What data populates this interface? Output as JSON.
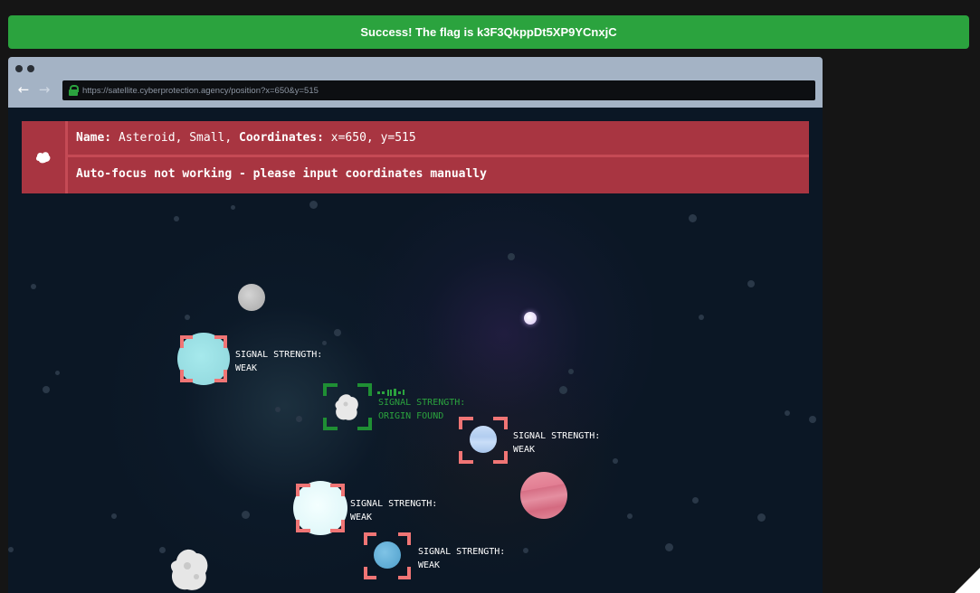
{
  "banner": {
    "text": "Success! The flag is k3F3QkppDt5XP9YCnxjC"
  },
  "browser": {
    "url": "https://satellite.cyberprotection.agency/position?x=650&y=515",
    "back_icon": "arrow-left-icon",
    "forward_icon": "arrow-right-icon",
    "lock_icon": "lock-icon"
  },
  "info": {
    "name_key": "Name:",
    "name_value": "Asteroid, Small,",
    "coords_key": "Coordinates:",
    "coords_value": "x=650, y=515",
    "message": "Auto-focus not working - please input coordinates manually"
  },
  "targets": [
    {
      "id": "cyan-planet",
      "label_line1": "SIGNAL STRENGTH:",
      "label_line2": "WEAK",
      "status": "weak"
    },
    {
      "id": "small-asteroid",
      "label_line1": "SIGNAL STRENGTH:",
      "label_line2": "ORIGIN FOUND",
      "status": "found"
    },
    {
      "id": "blue-planet",
      "label_line1": "SIGNAL STRENGTH:",
      "label_line2": "WEAK",
      "status": "weak"
    },
    {
      "id": "white-planet",
      "label_line1": "SIGNAL STRENGTH:",
      "label_line2": "WEAK",
      "status": "weak"
    },
    {
      "id": "small-blue-planet",
      "label_line1": "SIGNAL STRENGTH:",
      "label_line2": "WEAK",
      "status": "weak"
    }
  ],
  "colors": {
    "success": "#2ba33e",
    "panel": "#a83541",
    "bracket_weak": "#f07575",
    "bracket_found": "#1f8f34"
  }
}
